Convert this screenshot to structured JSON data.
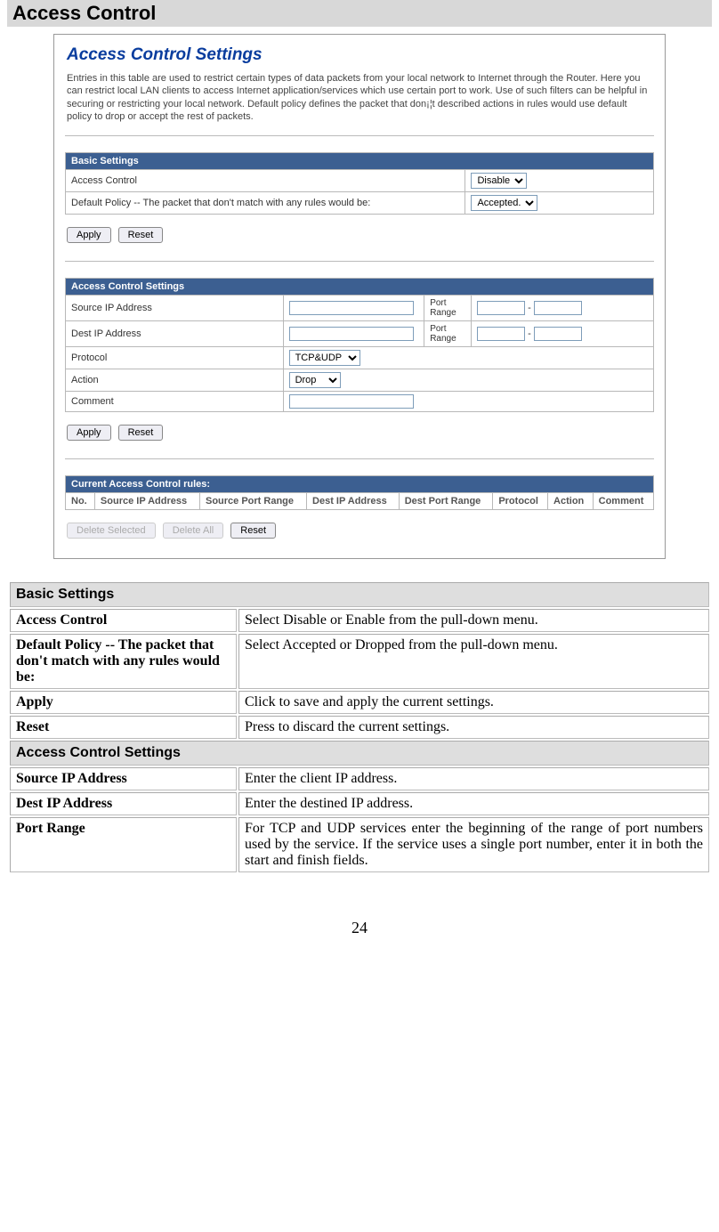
{
  "page_title": "Access Control",
  "screenshot": {
    "heading": "Access Control Settings",
    "intro": "Entries in this table are used to restrict certain types of data packets from your local network to Internet through the Router. Here you can restrict local LAN clients to access Internet application/services which use certain port to work. Use of such filters can be helpful in securing or restricting your local network. Default policy defines the packet that don¡¦t described actions in rules would use default policy to drop or accept the rest of packets.",
    "basic": {
      "header": "Basic Settings",
      "rows": {
        "ac_label": "Access Control",
        "ac_value": "Disable",
        "dp_label": "Default Policy -- The packet that don't match with any rules would be:",
        "dp_value": "Accepted."
      }
    },
    "acs": {
      "header": "Access Control Settings",
      "rows": {
        "src_label": "Source IP Address",
        "port_label1": "Port Range",
        "dest_label": "Dest IP Address",
        "port_label2": "Port Range",
        "proto_label": "Protocol",
        "proto_value": "TCP&UDP",
        "action_label": "Action",
        "action_value": "Drop",
        "comment_label": "Comment"
      }
    },
    "current": {
      "header": "Current Access Control rules:",
      "cols": [
        "No.",
        "Source IP Address",
        "Source Port Range",
        "Dest IP Address",
        "Dest Port Range",
        "Protocol",
        "Action",
        "Comment"
      ]
    },
    "buttons": {
      "apply": "Apply",
      "reset": "Reset",
      "delete_selected": "Delete Selected",
      "delete_all": "Delete All"
    }
  },
  "definitions": {
    "basic": {
      "header": "Basic Settings",
      "rows": [
        {
          "label": "Access  Control",
          "value": "Select Disable or Enable from the pull-down menu."
        },
        {
          "label": "Default Policy -- The packet that don't match with any rules would be:",
          "value": "Select Accepted or Dropped from the pull-down menu."
        },
        {
          "label": "Apply",
          "value": "Click to save and apply the current settings."
        },
        {
          "label": "Reset",
          "value": "Press to discard the current settings."
        }
      ]
    },
    "acs": {
      "header": "Access Control Settings",
      "rows": [
        {
          "label": "Source IP Address",
          "value": "Enter the client IP address."
        },
        {
          "label": "Dest IP Address",
          "value": "Enter the destined IP address."
        },
        {
          "label": "Port Range",
          "value": "For TCP and UDP services enter the beginning of the range of port numbers used by the service. If the service uses a single port number, enter it in both the start and finish fields."
        }
      ]
    }
  },
  "page_number": "24"
}
